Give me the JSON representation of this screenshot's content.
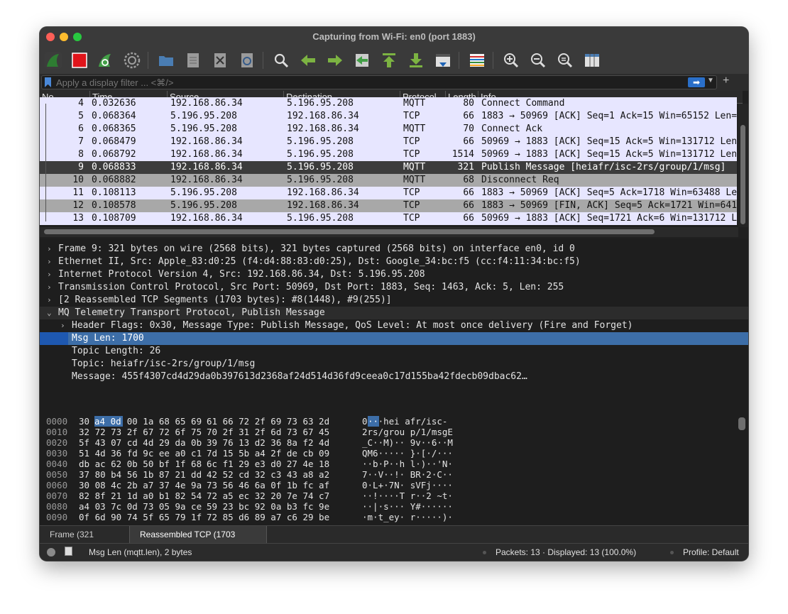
{
  "window": {
    "title": "Capturing from Wi-Fi: en0 (port 1883)"
  },
  "toolbar": {
    "buttons": [
      "shark-fin-start-icon",
      "stop-icon",
      "restart-icon",
      "options-gear-icon",
      "open-folder-icon",
      "save-file-icon",
      "close-file-icon",
      "reload-icon",
      "find-icon",
      "back-arrow-icon",
      "forward-arrow-icon",
      "go-to-packet-icon",
      "first-packet-icon",
      "last-packet-icon",
      "autoscroll-icon",
      "colorize-icon",
      "zoom-in-icon",
      "zoom-out-icon",
      "zoom-reset-icon",
      "resize-columns-icon"
    ]
  },
  "filter": {
    "placeholder": "Apply a display filter ... <⌘/>",
    "add_label": "+"
  },
  "packet_list": {
    "columns": [
      "No.",
      "Time",
      "Source",
      "Destination",
      "Protocol",
      "Length",
      "Info"
    ],
    "rows": [
      {
        "no": "4",
        "time": "0.032636",
        "src": "192.168.86.34",
        "dst": "5.196.95.208",
        "proto": "MQTT",
        "len": "80",
        "info": "Connect Command",
        "bg": "#e7e6ff"
      },
      {
        "no": "5",
        "time": "0.068364",
        "src": "5.196.95.208",
        "dst": "192.168.86.34",
        "proto": "TCP",
        "len": "66",
        "info": "1883 → 50969 [ACK] Seq=1 Ack=15 Win=65152 Len=",
        "bg": "#e7e6ff"
      },
      {
        "no": "6",
        "time": "0.068365",
        "src": "5.196.95.208",
        "dst": "192.168.86.34",
        "proto": "MQTT",
        "len": "70",
        "info": "Connect Ack",
        "bg": "#e7e6ff"
      },
      {
        "no": "7",
        "time": "0.068479",
        "src": "192.168.86.34",
        "dst": "5.196.95.208",
        "proto": "TCP",
        "len": "66",
        "info": "50969 → 1883 [ACK] Seq=15 Ack=5 Win=131712 Len",
        "bg": "#e7e6ff"
      },
      {
        "no": "8",
        "time": "0.068792",
        "src": "192.168.86.34",
        "dst": "5.196.95.208",
        "proto": "TCP",
        "len": "1514",
        "info": "50969 → 1883 [ACK] Seq=15 Ack=5 Win=131712 Len",
        "bg": "#e7e6ff"
      },
      {
        "no": "9",
        "time": "0.068833",
        "src": "192.168.86.34",
        "dst": "5.196.95.208",
        "proto": "MQTT",
        "len": "321",
        "info": "Publish Message [heiafr/isc-2rs/group/1/msg]",
        "bg": "#3c3c3c",
        "selected": true
      },
      {
        "no": "10",
        "time": "0.068882",
        "src": "192.168.86.34",
        "dst": "5.196.95.208",
        "proto": "MQTT",
        "len": "68",
        "info": "Disconnect Req",
        "bg": "#a8a8a8"
      },
      {
        "no": "11",
        "time": "0.108113",
        "src": "5.196.95.208",
        "dst": "192.168.86.34",
        "proto": "TCP",
        "len": "66",
        "info": "1883 → 50969 [ACK] Seq=5 Ack=1718 Win=63488 Le",
        "bg": "#e7e6ff"
      },
      {
        "no": "12",
        "time": "0.108578",
        "src": "5.196.95.208",
        "dst": "192.168.86.34",
        "proto": "TCP",
        "len": "66",
        "info": "1883 → 50969 [FIN, ACK] Seq=5 Ack=1721 Win=641",
        "bg": "#a8a8a8"
      },
      {
        "no": "13",
        "time": "0.108709",
        "src": "192.168.86.34",
        "dst": "5.196.95.208",
        "proto": "TCP",
        "len": "66",
        "info": "50969 → 1883 [ACK] Seq=1721 Ack=6 Win=131712 L",
        "bg": "#e7e6ff"
      }
    ]
  },
  "details": {
    "rows": [
      {
        "text": "Frame 9: 321 bytes on wire (2568 bits), 321 bytes captured (2568 bits) on interface en0, id 0",
        "arrow": "›",
        "indent": 0
      },
      {
        "text": "Ethernet II, Src: Apple_83:d0:25 (f4:d4:88:83:d0:25), Dst: Google_34:bc:f5 (cc:f4:11:34:bc:f5)",
        "arrow": "›",
        "indent": 0
      },
      {
        "text": "Internet Protocol Version 4, Src: 192.168.86.34, Dst: 5.196.95.208",
        "arrow": "›",
        "indent": 0
      },
      {
        "text": "Transmission Control Protocol, Src Port: 50969, Dst Port: 1883, Seq: 1463, Ack: 5, Len: 255",
        "arrow": "›",
        "indent": 0
      },
      {
        "text": "[2 Reassembled TCP Segments (1703 bytes): #8(1448), #9(255)]",
        "arrow": "›",
        "indent": 0
      },
      {
        "text": "MQ Telemetry Transport Protocol, Publish Message",
        "arrow": "⌄",
        "indent": 0
      },
      {
        "text": "Header Flags: 0x30, Message Type: Publish Message, QoS Level: At most once delivery (Fire and Forget)",
        "arrow": "›",
        "indent": 1
      },
      {
        "text": "Msg Len: 1700",
        "arrow": "",
        "indent": 1,
        "selected": true
      },
      {
        "text": "Topic Length: 26",
        "arrow": "",
        "indent": 1
      },
      {
        "text": "Topic: heiafr/isc-2rs/group/1/msg",
        "arrow": "",
        "indent": 1
      },
      {
        "text": "Message: 455f4307cd4d29da0b397613d2368af24d514d36fd9ceea0c17d155ba42fdecb09dbac62…",
        "arrow": "",
        "indent": 1
      }
    ]
  },
  "hex": {
    "rows": [
      {
        "off": "0000",
        "h1": "30 a4 0d 00 1a 68 65 69",
        "h2": "61 66 72 2f 69 73 63 2d",
        "ascii": "0···hei afr/isc-"
      },
      {
        "off": "0010",
        "h1": "32 72 73 2f 67 72 6f 75",
        "h2": "70 2f 31 2f 6d 73 67 45",
        "ascii": "2rs/grou p/1/msgE"
      },
      {
        "off": "0020",
        "h1": "5f 43 07 cd 4d 29 da 0b",
        "h2": "39 76 13 d2 36 8a f2 4d",
        "ascii": "_C··M)·· 9v··6··M"
      },
      {
        "off": "0030",
        "h1": "51 4d 36 fd 9c ee a0 c1",
        "h2": "7d 15 5b a4 2f de cb 09",
        "ascii": "QM6····· }·[·/···"
      },
      {
        "off": "0040",
        "h1": "db ac 62 0b 50 bf 1f 68",
        "h2": "6c f1 29 e3 d0 27 4e 18",
        "ascii": "··b·P··h l·)··'N·"
      },
      {
        "off": "0050",
        "h1": "37 80 b4 56 1b 87 21 dd",
        "h2": "42 52 cd 32 c3 43 a8 a2",
        "ascii": "7··V··!· BR·2·C··"
      },
      {
        "off": "0060",
        "h1": "30 08 4c 2b a7 37 4e 9a",
        "h2": "73 56 46 6a 0f 1b fc af",
        "ascii": "0·L+·7N· sVFj····"
      },
      {
        "off": "0070",
        "h1": "82 8f 21 1d a0 b1 82 54",
        "h2": "72 a5 ec 32 20 7e 74 c7",
        "ascii": "··!····T r··2 ~t·"
      },
      {
        "off": "0080",
        "h1": "a4 03 7c 0d 73 05 9a ce",
        "h2": "59 23 bc 92 0a b3 fc 9e",
        "ascii": "··|·s··· Y#······"
      },
      {
        "off": "0090",
        "h1": "0f 6d 90 74 5f 65 79 1f",
        "h2": "72 85 d6 89 a7 c6 29 be",
        "ascii": "·m·t_ey· r·····)·"
      }
    ],
    "highlight_hex": "a4 0d",
    "highlight_ascii": "··"
  },
  "bytes_tabs": [
    "Frame (321 bytes)",
    "Reassembled TCP (1703 bytes)"
  ],
  "status": {
    "field": "Msg Len (mqtt.len), 2 bytes",
    "packets": "Packets: 13 · Displayed: 13 (100.0%)",
    "profile": "Profile: Default"
  }
}
